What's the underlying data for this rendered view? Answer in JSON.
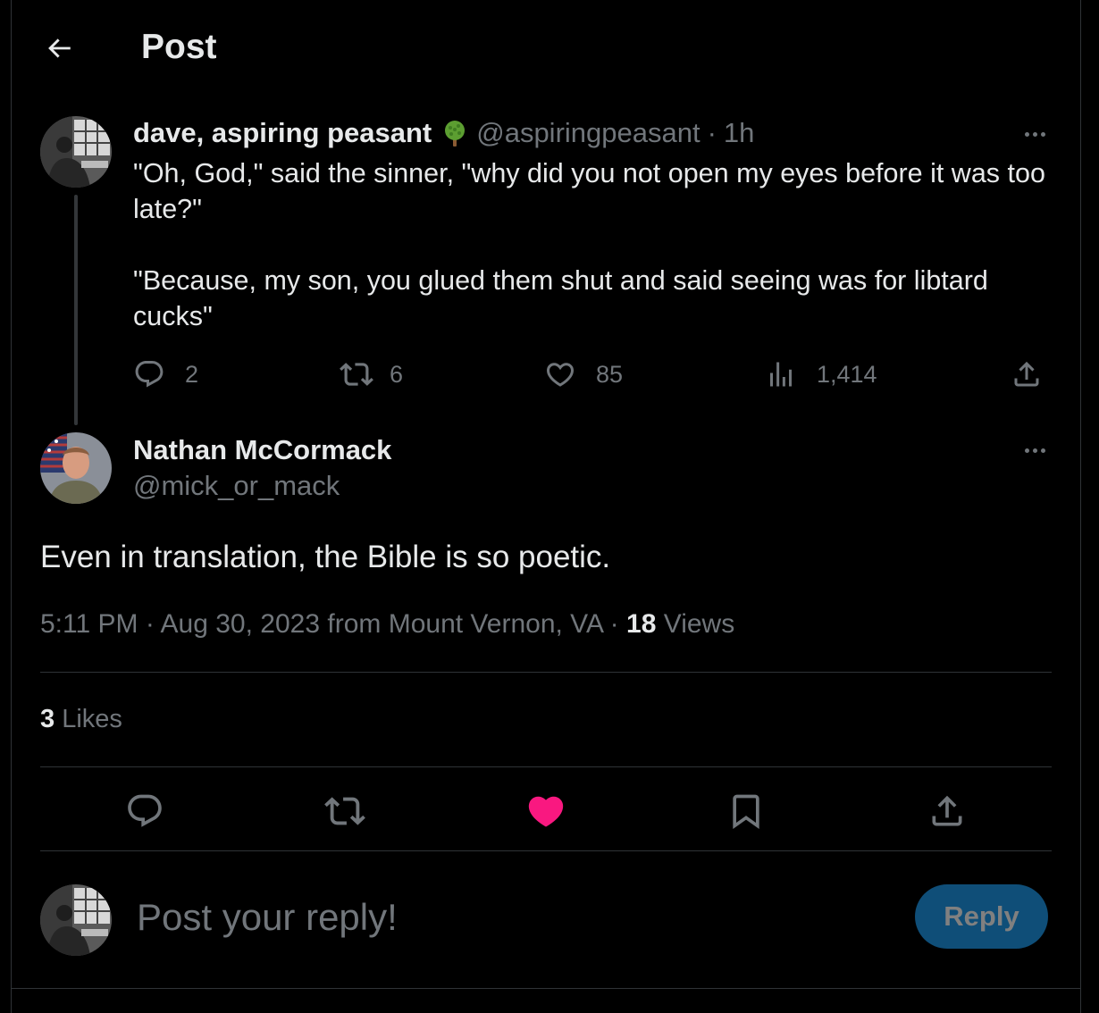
{
  "header": {
    "back_icon": "arrow-left-icon",
    "title": "Post"
  },
  "parent_post": {
    "author_name": "dave, aspiring peasant",
    "badge_icon": "tree-emoji-icon",
    "handle": "@aspiringpeasant",
    "separator": "·",
    "time": "1h",
    "paragraphs": [
      "\"Oh, God,\" said the sinner, \"why did you not open my eyes before it was too late?\"",
      "\"Because, my son, you glued them shut and said seeing was for libtard cucks\""
    ],
    "actions": {
      "replies": "2",
      "reposts": "6",
      "likes": "85",
      "views": "1,414"
    }
  },
  "main_post": {
    "author_name": "Nathan McCormack",
    "handle": "@mick_or_mack",
    "text": "Even in translation, the Bible is so poetic.",
    "meta": {
      "time": "5:11 PM",
      "sep1": "·",
      "date": "Aug 30, 2023",
      "from_text": "from Mount Vernon, VA",
      "sep2": "·",
      "views_count": "18",
      "views_label": "Views"
    },
    "likes_count": "3",
    "likes_label": "Likes",
    "liked": true
  },
  "reply_composer": {
    "placeholder": "Post your reply!",
    "button_label": "Reply"
  },
  "colors": {
    "background": "#000000",
    "text_primary": "#e7e9ea",
    "text_secondary": "#71767b",
    "divider": "#2f3336",
    "like_active": "#f91880",
    "reply_button": "#0f4e78"
  }
}
